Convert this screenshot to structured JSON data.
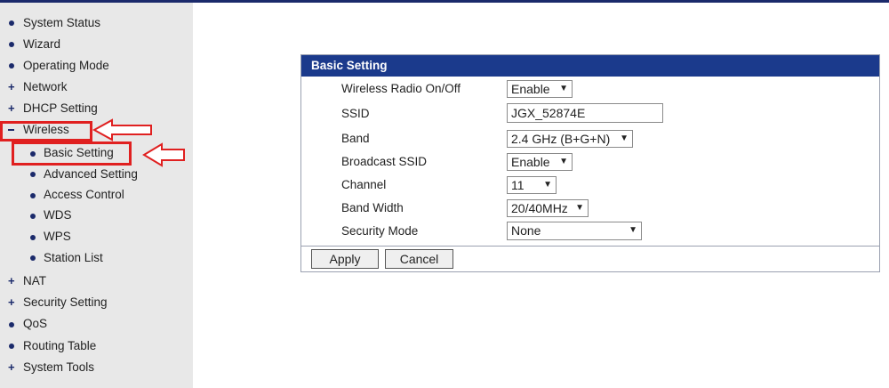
{
  "sidebar": {
    "items": [
      {
        "label": "System Status"
      },
      {
        "label": "Wizard"
      },
      {
        "label": "Operating Mode"
      },
      {
        "label": "Network"
      },
      {
        "label": "DHCP Setting"
      },
      {
        "label": "Wireless"
      },
      {
        "label": "Basic Setting"
      },
      {
        "label": "Advanced Setting"
      },
      {
        "label": "Access Control"
      },
      {
        "label": "WDS"
      },
      {
        "label": "WPS"
      },
      {
        "label": "Station List"
      },
      {
        "label": "NAT"
      },
      {
        "label": "Security Setting"
      },
      {
        "label": "QoS"
      },
      {
        "label": "Routing Table"
      },
      {
        "label": "System Tools"
      }
    ]
  },
  "panel": {
    "title": "Basic Setting",
    "rows": [
      {
        "label": "Wireless Radio On/Off",
        "value": "Enable"
      },
      {
        "label": "SSID",
        "value": "JGX_52874E"
      },
      {
        "label": "Band",
        "value": "2.4 GHz (B+G+N)"
      },
      {
        "label": "Broadcast SSID",
        "value": "Enable"
      },
      {
        "label": "Channel",
        "value": "11"
      },
      {
        "label": "Band Width",
        "value": "20/40MHz"
      },
      {
        "label": "Security Mode",
        "value": "None"
      }
    ],
    "apply_label": "Apply",
    "cancel_label": "Cancel"
  },
  "colors": {
    "accent": "#1b3a8c",
    "highlight": "#e02020",
    "sidebar_bg": "#e8e8e8"
  }
}
